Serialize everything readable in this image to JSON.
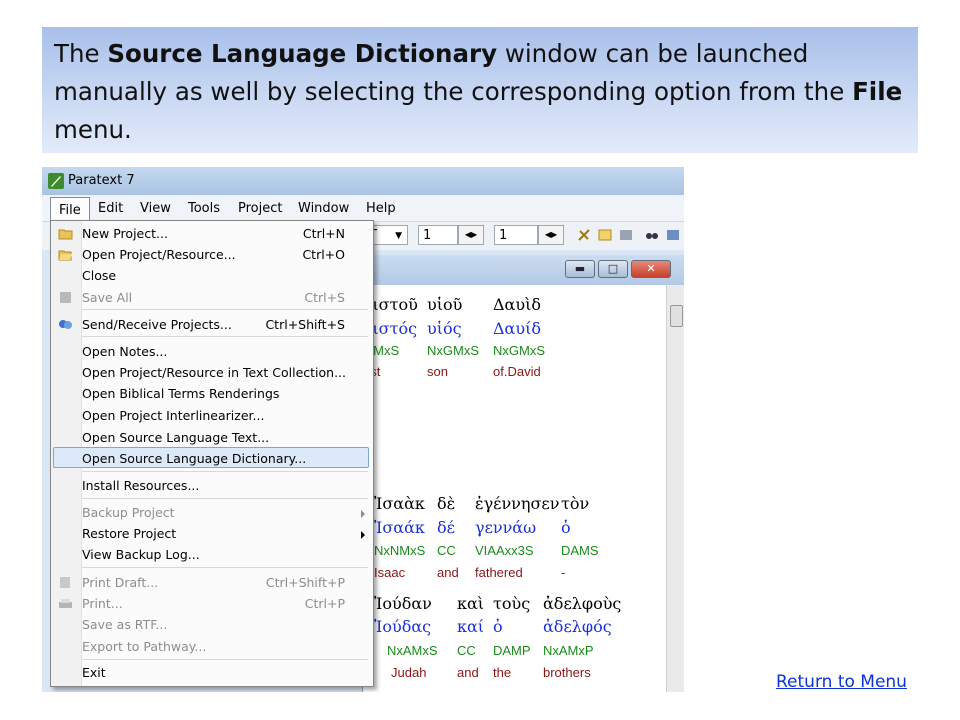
{
  "banner": {
    "text_1": "The ",
    "text_bold_1": "Source Language Dictionary",
    "text_2": " window can be launched manually as well by selecting the corresponding option from the ",
    "text_bold_2": "File",
    "text_3": " menu."
  },
  "app": {
    "title": "Paratext 7",
    "menus": [
      "File",
      "Edit",
      "View",
      "Tools",
      "Project",
      "Window",
      "Help"
    ],
    "toolbar": {
      "book_value": "T",
      "chapter_value": "1",
      "verse_value": "1"
    }
  },
  "file_menu": {
    "items": [
      {
        "label": "New Project...",
        "shortcut": "Ctrl+N"
      },
      {
        "label": "Open Project/Resource...",
        "shortcut": "Ctrl+O"
      },
      {
        "label": "Close",
        "shortcut": ""
      },
      {
        "label": "Save All",
        "shortcut": "Ctrl+S",
        "disabled": true
      },
      {
        "label": "Send/Receive Projects...",
        "shortcut": "Ctrl+Shift+S"
      },
      {
        "label": "Open Notes...",
        "shortcut": ""
      },
      {
        "label": "Open Project/Resource in Text Collection...",
        "shortcut": ""
      },
      {
        "label": "Open Biblical Terms Renderings",
        "shortcut": ""
      },
      {
        "label": "Open Project Interlinearizer...",
        "shortcut": ""
      },
      {
        "label": "Open Source Language Text...",
        "shortcut": ""
      },
      {
        "label": "Open Source Language Dictionary...",
        "shortcut": "",
        "highlighted": true
      },
      {
        "label": "Install Resources...",
        "shortcut": ""
      },
      {
        "label": "Backup Project",
        "shortcut": "",
        "disabled": true,
        "submenu": true
      },
      {
        "label": "Restore Project",
        "shortcut": "",
        "submenu": true
      },
      {
        "label": "View Backup Log...",
        "shortcut": ""
      },
      {
        "label": "Print Draft...",
        "shortcut": "Ctrl+Shift+P",
        "disabled": true
      },
      {
        "label": "Print...",
        "shortcut": "Ctrl+P",
        "disabled": true
      },
      {
        "label": "Save as RTF...",
        "shortcut": "",
        "disabled": true
      },
      {
        "label": "Export to Pathway...",
        "shortcut": "",
        "disabled": true
      },
      {
        "label": "Exit",
        "shortcut": ""
      }
    ]
  },
  "interlinear": {
    "block1": {
      "greek": [
        "ριστοῦ",
        "υἱοῦ",
        "Δαυὶδ"
      ],
      "lemma": [
        "ριστός",
        "υἱός",
        "Δαυίδ"
      ],
      "parse": [
        "GMxS",
        "NxGMxS",
        "NxGMxS"
      ],
      "gloss": [
        "rist",
        "son",
        "of.David"
      ]
    },
    "block2": {
      "greek": [
        "Ἰσαὰκ",
        "δὲ",
        "ἐγέννησεν",
        "τὸν"
      ],
      "lemma": [
        "Ἰσαάκ",
        "δέ",
        "γεννάω",
        "ὁ"
      ],
      "parse": [
        "NxNMxS",
        "CC",
        "VIAAxx3S",
        "DAMS"
      ],
      "gloss": [
        "Isaac",
        "and",
        "fathered",
        "-"
      ]
    },
    "block3": {
      "greek": [
        "Ἰούδαν",
        "καὶ",
        "τοὺς",
        "ἀδελφοὺς"
      ],
      "lemma": [
        "Ἰούδας",
        "καί",
        "ὁ",
        "ἀδελφός"
      ],
      "parse": [
        "S",
        "NxAMxS",
        "CC",
        "DAMP",
        "NxAMxP"
      ],
      "gloss": [
        "Judah",
        "and",
        "the",
        "brothers"
      ]
    }
  },
  "footer": {
    "return_link": "Return to Menu"
  },
  "colors": {
    "banner_top": "#a9c0ea",
    "greek_lemma": "#1a2fd6",
    "parsing": "#1b8a1b",
    "gloss": "#8b1515",
    "link": "#0b32d9"
  },
  "icons": [
    "paratext-app-icon",
    "folder-icon",
    "open-folder-icon",
    "save-icon",
    "send-receive-icon",
    "print-icon",
    "minimize-icon",
    "maximize-icon",
    "close-icon"
  ]
}
